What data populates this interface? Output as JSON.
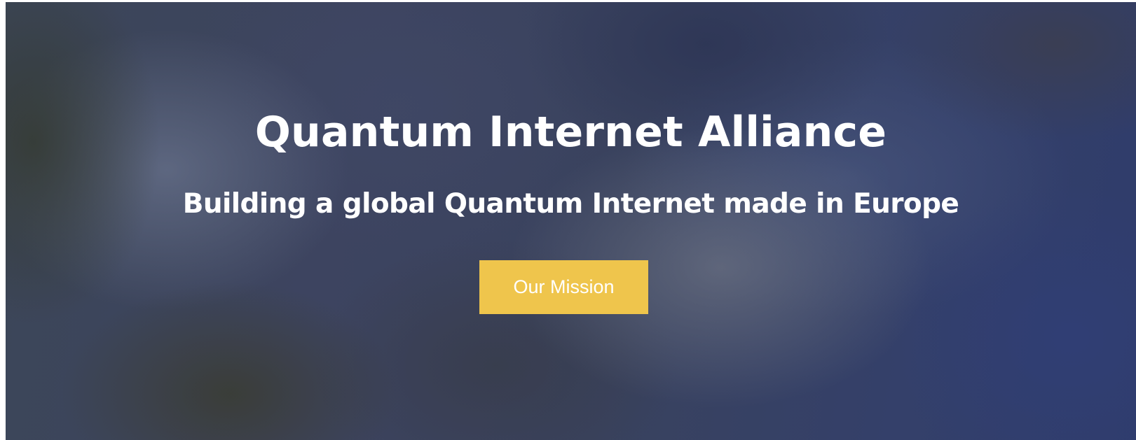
{
  "hero": {
    "title": "Quantum Internet Alliance",
    "subtitle": "Building a global Quantum Internet made in Europe",
    "cta_label": "Our Mission"
  },
  "colors": {
    "cta_background": "#efc54c",
    "text": "#ffffff",
    "background_base": "#3b4462"
  }
}
